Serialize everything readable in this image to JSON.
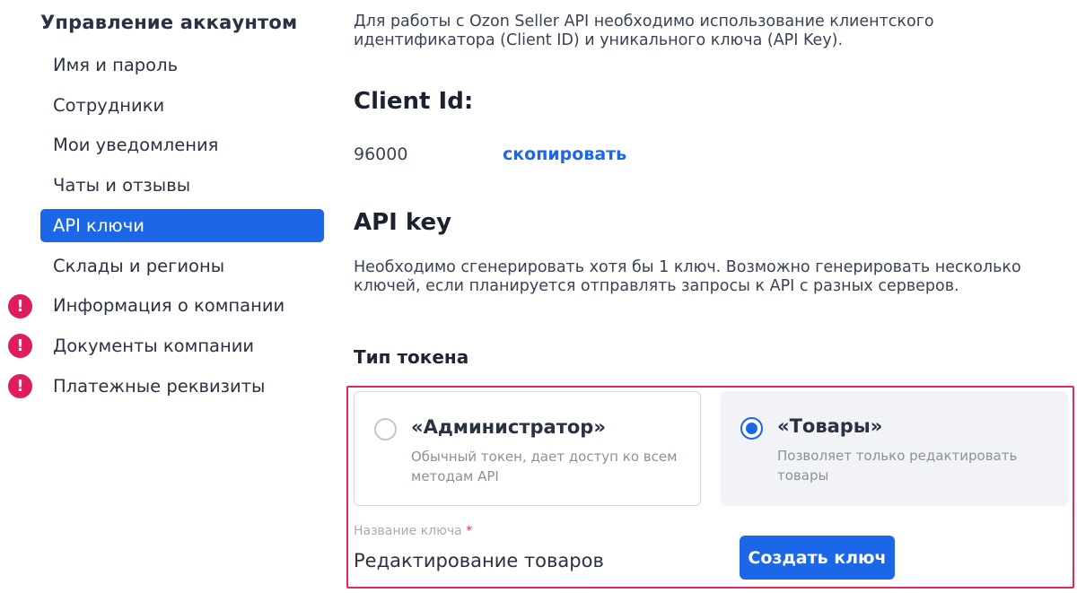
{
  "sidebar": {
    "title": "Управление аккаунтом",
    "items": [
      {
        "label": "Имя и пароль"
      },
      {
        "label": "Сотрудники"
      },
      {
        "label": "Мои уведомления"
      },
      {
        "label": "Чаты и отзывы"
      },
      {
        "label": "API ключи",
        "active": true
      },
      {
        "label": "Склады и регионы"
      },
      {
        "label": "Информация о компании",
        "warning": true
      },
      {
        "label": "Документы компании",
        "warning": true
      },
      {
        "label": "Платежные реквизиты",
        "warning": true
      }
    ],
    "warning_glyph": "!"
  },
  "main": {
    "intro": "Для работы с Ozon Seller API необходимо использование клиентского идентификатора (Client ID) и уникального ключа (API Key).",
    "client_id_heading": "Client Id:",
    "client_id_value": "96000",
    "copy_label": "скопировать",
    "api_key_heading": "API key",
    "api_key_description": "Необходимо сгенерировать хотя бы 1 ключ. Возможно генерировать несколько ключей, если планируется отправлять запросы к API с разных серверов.",
    "token_type_heading": "Тип токена",
    "token_options": [
      {
        "title": "«Администратор»",
        "description": "Обычный токен, дает доступ ко всем методам API",
        "selected": false
      },
      {
        "title": "«Товары»",
        "description": "Позволяет только редактировать товары",
        "selected": true
      }
    ],
    "key_name_label": "Название ключа",
    "required_mark": "*",
    "key_name_value": "Редактирование товаров",
    "create_button_label": "Создать ключ"
  },
  "colors": {
    "accent": "#1c66e8",
    "warning": "#e01c5c",
    "highlight_border": "#e3285f"
  }
}
